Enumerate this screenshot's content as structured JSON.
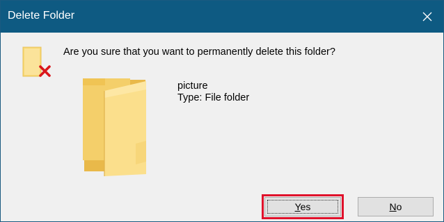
{
  "window": {
    "title": "Delete Folder",
    "close_icon": "close-icon",
    "titlebar_color": "#0e5a82"
  },
  "message": {
    "question": "Are you sure that you want to permanently delete this folder?"
  },
  "item": {
    "name": "picture",
    "type": "Type: File folder"
  },
  "icons": {
    "warning": "folder-delete-icon",
    "preview": "folder-icon"
  },
  "buttons": {
    "yes": "Yes",
    "no": "No"
  },
  "highlight_color": "#e0112b"
}
